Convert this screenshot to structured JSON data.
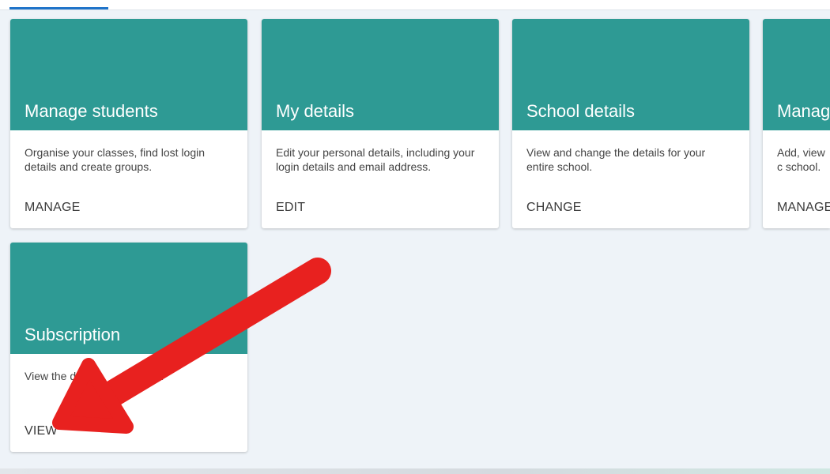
{
  "cards": [
    {
      "title": "Manage students",
      "description": "Organise your classes, find lost login details and create groups.",
      "action": "MANAGE"
    },
    {
      "title": "My details",
      "description": "Edit your personal details, including your login details and email address.",
      "action": "EDIT"
    },
    {
      "title": "School details",
      "description": "View and change the details for your entire school.",
      "action": "CHANGE"
    },
    {
      "title": "Manag",
      "description": "Add, view c school.",
      "action": "MANAGE"
    },
    {
      "title": "Subscription",
      "description": "View the d    of         cription.",
      "action": "VIEW"
    }
  ],
  "colors": {
    "card_header": "#2e9a94",
    "background": "#eef3f8",
    "active_tab": "#1f73c9",
    "annotation_arrow": "#e8211f"
  },
  "annotation": {
    "icon": "red-arrow-icon"
  }
}
